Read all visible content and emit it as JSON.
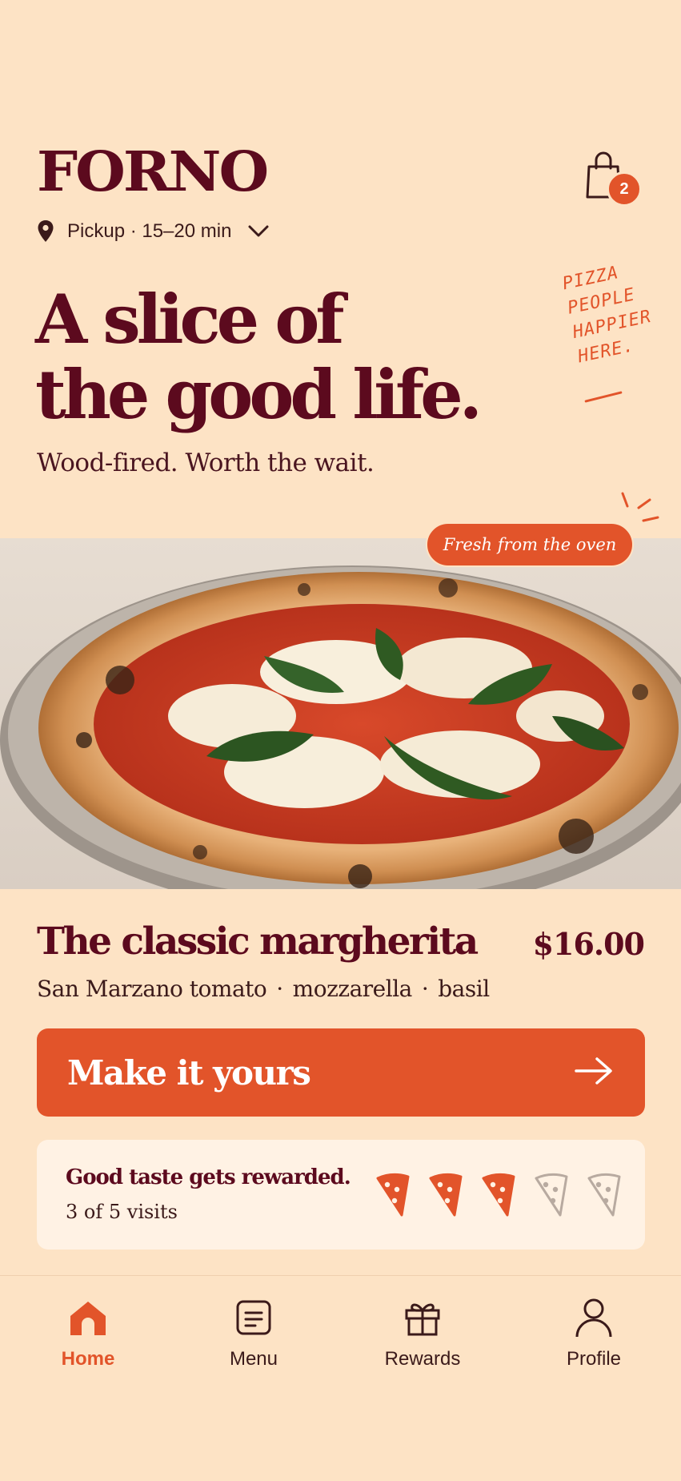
{
  "brand": {
    "logo": "FORNO",
    "location": "Pickup · 15–20 min",
    "cart_count": "2"
  },
  "hero": {
    "headline_line1": "A slice of",
    "headline_line2": "the good life.",
    "subhead": "Wood-fired. Worth the wait.",
    "scribble": [
      "PIZZA",
      "PEOPLE",
      "HAPPIER",
      "HERE."
    ],
    "ribbon": "Fresh from the oven"
  },
  "product": {
    "name": "The classic margherita",
    "price": "$16.00",
    "ingredients": [
      "San Marzano tomato",
      "·",
      "mozzarella",
      "·",
      "basil"
    ],
    "cta_label": "Make it yours"
  },
  "rewards": {
    "title": "Good taste gets rewarded.",
    "progress_text": "3 of 5 visits",
    "visits_done": 3,
    "visits_total": 5
  },
  "nav": {
    "items": [
      {
        "label": "Home",
        "icon": "home-icon",
        "active": true
      },
      {
        "label": "Menu",
        "icon": "menu-icon",
        "active": false
      },
      {
        "label": "Rewards",
        "icon": "gift-icon",
        "active": false
      },
      {
        "label": "Profile",
        "icon": "profile-icon",
        "active": false
      }
    ]
  },
  "colors": {
    "background": "#fde3c5",
    "brand_maroon": "#5c0a1e",
    "accent_orange": "#e2542a"
  }
}
